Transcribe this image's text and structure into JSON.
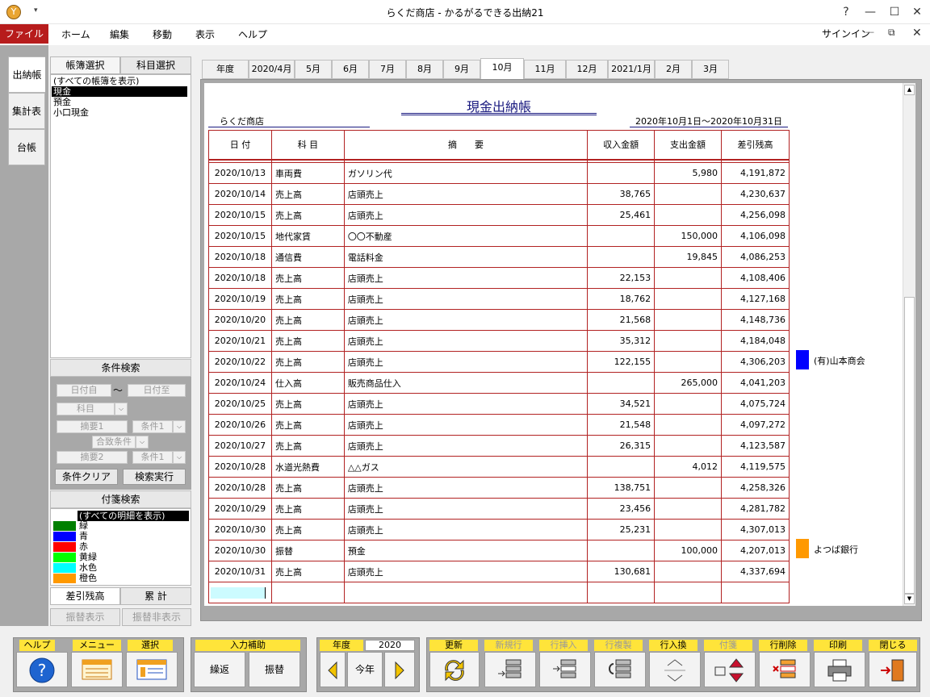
{
  "window": {
    "title": "らくだ商店 - かるがるできる出納21",
    "help": "?",
    "minimize": "—",
    "maximize": "☐",
    "close": "✕"
  },
  "ribbon": {
    "file": "ファイル",
    "menus": [
      "ホーム",
      "編集",
      "移動",
      "表示",
      "ヘルプ"
    ],
    "signin": "サインイン",
    "rb_min": "—",
    "rb_restore": "⧉",
    "rb_close": "✕"
  },
  "side_tabs": [
    "出納帳",
    "集計表",
    "台帳"
  ],
  "panel": {
    "tab_books": "帳簿選択",
    "tab_accounts": "科目選択",
    "books": [
      "(すべての帳簿を表示)",
      "現金",
      "預金",
      "小口現金"
    ],
    "cond_title": "条件検索",
    "date_from": "日付自",
    "tilde": "〜",
    "date_to": "日付至",
    "account": "科目",
    "summary1": "摘要1",
    "cond1": "条件1",
    "match": "合致条件",
    "summary2": "摘要2",
    "cond2": "条件1",
    "clear": "条件クリア",
    "search": "検索実行",
    "tag_title": "付箋検索",
    "tags": [
      {
        "label": "(すべての明細を表示)",
        "color": ""
      },
      {
        "label": "緑",
        "color": "#008000"
      },
      {
        "label": "青",
        "color": "#0000ff"
      },
      {
        "label": "赤",
        "color": "#ff0000"
      },
      {
        "label": "黄緑",
        "color": "#00ff00"
      },
      {
        "label": "水色",
        "color": "#00ffff"
      },
      {
        "label": "橙色",
        "color": "#ff9900"
      }
    ],
    "tab_balance": "差引残高",
    "tab_total": "累 計",
    "transfer_show": "振替表示",
    "transfer_hide": "振替非表示"
  },
  "months": [
    "年度",
    "2020/4月",
    "5月",
    "6月",
    "7月",
    "8月",
    "9月",
    "10月",
    "11月",
    "12月",
    "2021/1月",
    "2月",
    "3月"
  ],
  "active_month": "10月",
  "doc": {
    "title": "現金出納帳",
    "shop": "らくだ商店",
    "period": "2020年10月1日～2020年10月31日",
    "headers": [
      "日 付",
      "科 目",
      "摘　　要",
      "収入金額",
      "支出金額",
      "差引残高"
    ]
  },
  "rows": [
    [
      "2020/10/13",
      "車両費",
      "ガソリン代",
      "",
      "5,980",
      "4,191,872"
    ],
    [
      "2020/10/14",
      "売上高",
      "店頭売上",
      "38,765",
      "",
      "4,230,637"
    ],
    [
      "2020/10/15",
      "売上高",
      "店頭売上",
      "25,461",
      "",
      "4,256,098"
    ],
    [
      "2020/10/15",
      "地代家賃",
      "〇〇不動産",
      "",
      "150,000",
      "4,106,098"
    ],
    [
      "2020/10/18",
      "通信費",
      "電話料金",
      "",
      "19,845",
      "4,086,253"
    ],
    [
      "2020/10/18",
      "売上高",
      "店頭売上",
      "22,153",
      "",
      "4,108,406"
    ],
    [
      "2020/10/19",
      "売上高",
      "店頭売上",
      "18,762",
      "",
      "4,127,168"
    ],
    [
      "2020/10/20",
      "売上高",
      "店頭売上",
      "21,568",
      "",
      "4,148,736"
    ],
    [
      "2020/10/21",
      "売上高",
      "店頭売上",
      "35,312",
      "",
      "4,184,048"
    ],
    [
      "2020/10/22",
      "売上高",
      "店頭売上",
      "122,155",
      "",
      "4,306,203"
    ],
    [
      "2020/10/24",
      "仕入高",
      "販売商品仕入",
      "",
      "265,000",
      "4,041,203"
    ],
    [
      "2020/10/25",
      "売上高",
      "店頭売上",
      "34,521",
      "",
      "4,075,724"
    ],
    [
      "2020/10/26",
      "売上高",
      "店頭売上",
      "21,548",
      "",
      "4,097,272"
    ],
    [
      "2020/10/27",
      "売上高",
      "店頭売上",
      "26,315",
      "",
      "4,123,587"
    ],
    [
      "2020/10/28",
      "水道光熱費",
      "△△ガス",
      "",
      "4,012",
      "4,119,575"
    ],
    [
      "2020/10/28",
      "売上高",
      "店頭売上",
      "138,751",
      "",
      "4,258,326"
    ],
    [
      "2020/10/29",
      "売上高",
      "店頭売上",
      "23,456",
      "",
      "4,281,782"
    ],
    [
      "2020/10/30",
      "売上高",
      "店頭売上",
      "25,231",
      "",
      "4,307,013"
    ],
    [
      "2020/10/30",
      "振替",
      "預金",
      "",
      "100,000",
      "4,207,013"
    ],
    [
      "2020/10/31",
      "売上高",
      "店頭売上",
      "130,681",
      "",
      "4,337,694"
    ]
  ],
  "notes": [
    {
      "row": 9,
      "label": "(有)山本商会",
      "color": "#0000ff"
    },
    {
      "row": 18,
      "label": "よつば銀行",
      "color": "#ff9900"
    }
  ],
  "toolbar": {
    "help": "ヘルプ",
    "menu": "メニュー",
    "select": "選択",
    "input_assist": "入力補助",
    "repeat": "繰返",
    "transfer": "振替",
    "year": "年度",
    "year_value": "2020",
    "this_year": "今年",
    "update": "更新",
    "new_row": "新規行",
    "insert_row": "行挿入",
    "copy_row": "行複製",
    "swap_row": "行入換",
    "tag": "付箋",
    "delete_row": "行削除",
    "print": "印刷",
    "close": "閉じる"
  }
}
